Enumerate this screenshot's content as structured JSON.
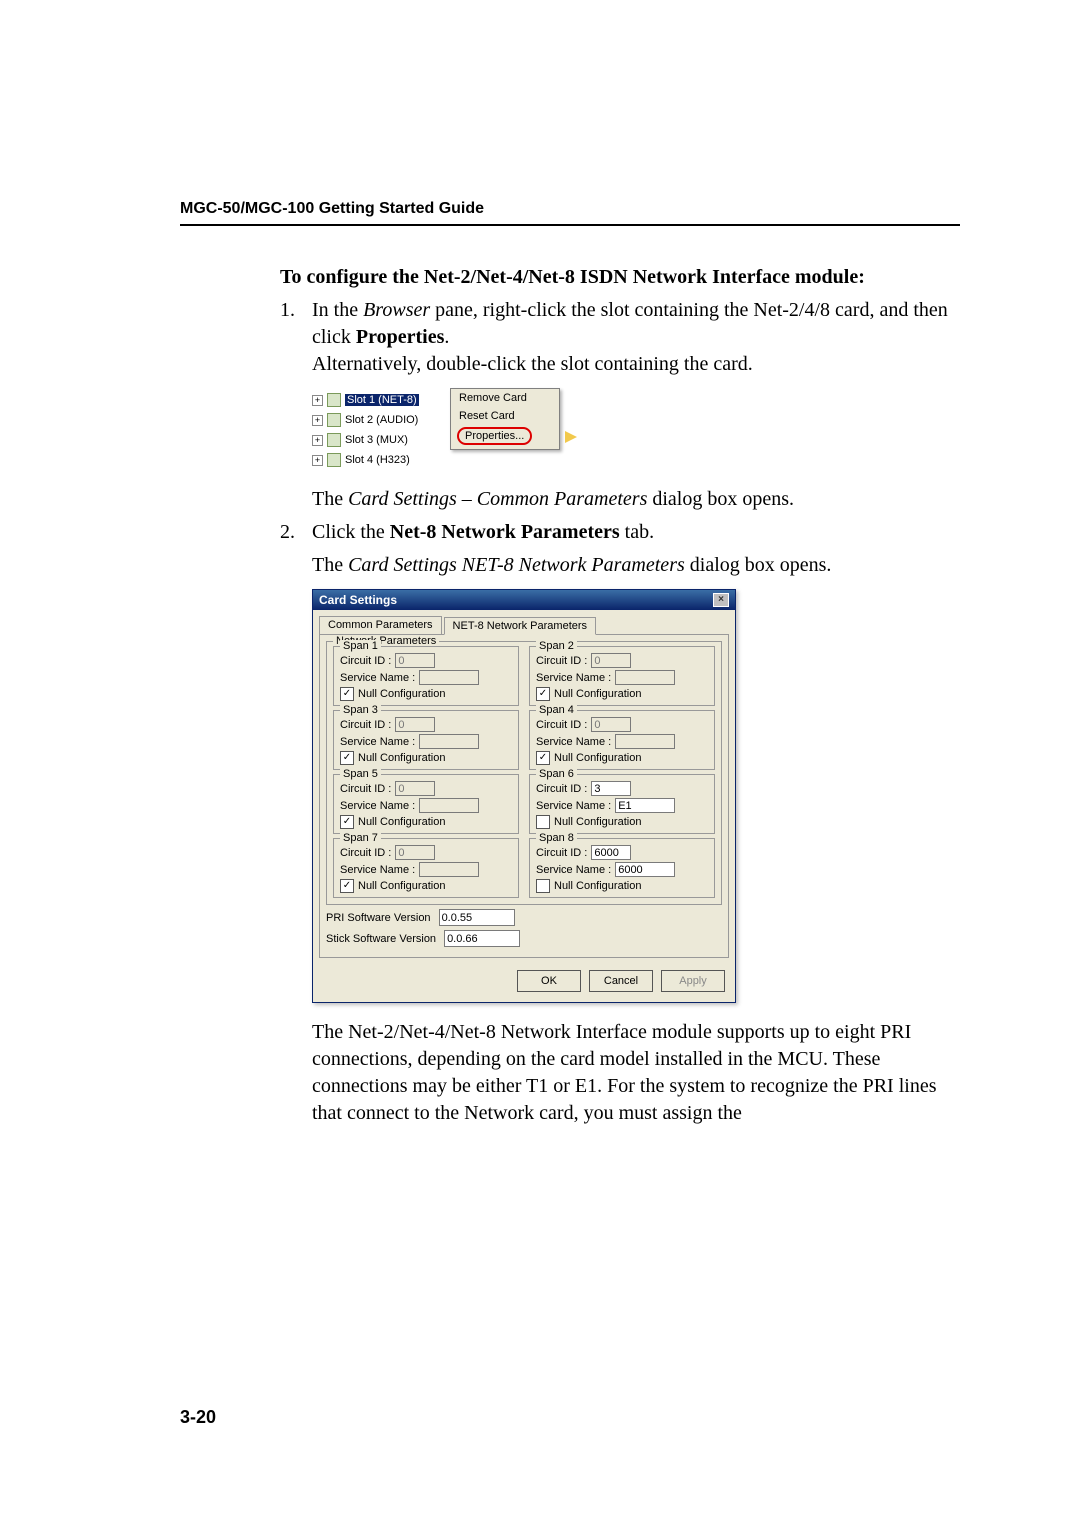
{
  "header": {
    "title": "MGC-50/MGC-100 Getting Started Guide"
  },
  "section_heading": "To configure the Net-2/Net-4/Net-8 ISDN Network Interface module:",
  "step1": {
    "num": "1.",
    "pre": "In the ",
    "browser_ital": "Browser",
    "mid": " pane, right-click the slot containing the Net-2/4/8 card, and then click ",
    "properties_bold": "Properties",
    "post": ".",
    "alt": "Alternatively, double-click the slot containing the card."
  },
  "tree": {
    "rows": [
      {
        "label": "Slot 1 (NET-8)",
        "selected": true
      },
      {
        "label": "Slot 2 (AUDIO)",
        "selected": false
      },
      {
        "label": "Slot 3 (MUX)",
        "selected": false
      },
      {
        "label": "Slot 4 (H323)",
        "selected": false
      }
    ],
    "menu": {
      "remove": "Remove Card",
      "reset": "Reset Card",
      "props": "Properties..."
    }
  },
  "after_tree": {
    "pre": "The ",
    "ital": "Card Settings – Common Parameters",
    "post": " dialog box opens."
  },
  "step2": {
    "num": "2.",
    "pre": "Click the ",
    "bold": "Net-8 Network Parameters",
    "post": " tab."
  },
  "after_step2": {
    "pre": "The ",
    "ital": "Card Settings NET-8 Network Parameters",
    "post": " dialog box opens."
  },
  "dialog": {
    "title": "Card Settings",
    "tabs": {
      "common": "Common Parameters",
      "net8": "NET-8 Network Parameters"
    },
    "group_title": "Network Parameters",
    "labels": {
      "circuit": "Circuit ID :",
      "service": "Service Name :",
      "nullcfg": "Null Configuration"
    },
    "spans": [
      {
        "title": "Span 1",
        "circuit": "0",
        "service": "",
        "null_checked": true,
        "disabled": true
      },
      {
        "title": "Span 2",
        "circuit": "0",
        "service": "",
        "null_checked": true,
        "disabled": true
      },
      {
        "title": "Span 3",
        "circuit": "0",
        "service": "",
        "null_checked": true,
        "disabled": true
      },
      {
        "title": "Span 4",
        "circuit": "0",
        "service": "",
        "null_checked": true,
        "disabled": true
      },
      {
        "title": "Span 5",
        "circuit": "0",
        "service": "",
        "null_checked": true,
        "disabled": true
      },
      {
        "title": "Span 6",
        "circuit": "3",
        "service": "E1",
        "null_checked": false,
        "disabled": false
      },
      {
        "title": "Span 7",
        "circuit": "0",
        "service": "",
        "null_checked": true,
        "disabled": true
      },
      {
        "title": "Span 8",
        "circuit": "6000",
        "service": "6000",
        "null_checked": false,
        "disabled": false
      }
    ],
    "versions": {
      "pri_label": "PRI Software Version",
      "pri_value": "0.0.55",
      "stick_label": "Stick Software Version",
      "stick_value": "0.0.66"
    },
    "buttons": {
      "ok": "OK",
      "cancel": "Cancel",
      "apply": "Apply"
    }
  },
  "para_after_dialog": "The Net-2/Net-4/Net-8 Network Interface module supports up to eight PRI connections, depending on the card model installed in the MCU. These connections may be either T1 or E1. For the system to recognize the PRI lines that connect to the Network card, you must assign the",
  "page_number": "3-20"
}
